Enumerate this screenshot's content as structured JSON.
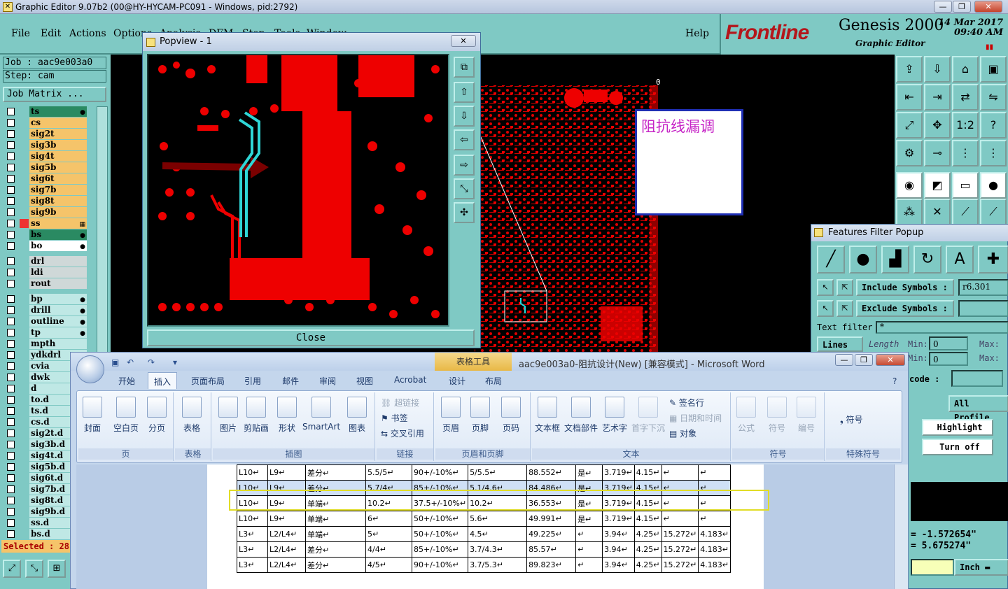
{
  "window": {
    "title": "Graphic Editor 9.07b2 (00@HY-HYCAM-PC091 - Windows, pid:2792)",
    "min": "—",
    "max": "❐",
    "close": "✕"
  },
  "menu": {
    "items": [
      "File",
      "Edit",
      "Actions",
      "Options",
      "Analysis",
      "DFM",
      "Step",
      "Tools",
      "Window"
    ],
    "help": "Help"
  },
  "brand": {
    "logo": "Frontline",
    "product": "Genesis 2000",
    "subtitle": "Graphic Editor",
    "date_line1": "14 Mar 2017",
    "date_line2": "09:40 AM"
  },
  "job": {
    "job": "Job : aac9e003a0",
    "step": "Step: cam",
    "matrix_btn": "Job Matrix ..."
  },
  "layers": [
    {
      "name": "ts",
      "style": "grn",
      "mark": "●"
    },
    {
      "name": "cs",
      "style": "yel",
      "mark": ""
    },
    {
      "name": "sig2t",
      "style": "yel",
      "mark": ""
    },
    {
      "name": "sig3b",
      "style": "yel",
      "mark": ""
    },
    {
      "name": "sig4t",
      "style": "yel",
      "mark": ""
    },
    {
      "name": "sig5b",
      "style": "yel",
      "mark": ""
    },
    {
      "name": "sig6t",
      "style": "yel",
      "mark": ""
    },
    {
      "name": "sig7b",
      "style": "yel",
      "mark": ""
    },
    {
      "name": "sig8t",
      "style": "yel",
      "mark": ""
    },
    {
      "name": "sig9b",
      "style": "yel",
      "mark": ""
    },
    {
      "name": "ss",
      "style": "yel",
      "mark": "▦"
    },
    {
      "name": "bs",
      "style": "grn",
      "mark": "●"
    },
    {
      "name": "bo",
      "style": "wht",
      "mark": "●"
    },
    {
      "name": "drl",
      "style": "gry",
      "mark": ""
    },
    {
      "name": "ldi",
      "style": "gry",
      "mark": ""
    },
    {
      "name": "rout",
      "style": "gry",
      "mark": ""
    },
    {
      "name": "bp",
      "style": "cyn",
      "mark": "●"
    },
    {
      "name": "drill",
      "style": "cyn",
      "mark": "●"
    },
    {
      "name": "outline",
      "style": "cyn",
      "mark": "●"
    },
    {
      "name": "tp",
      "style": "cyn",
      "mark": "●"
    },
    {
      "name": "mpth",
      "style": "cyn",
      "mark": ""
    },
    {
      "name": "ydkdrl",
      "style": "cyn",
      "mark": ""
    },
    {
      "name": "cvia",
      "style": "cyn",
      "mark": ""
    },
    {
      "name": "dwk",
      "style": "cyn",
      "mark": ""
    },
    {
      "name": "d",
      "style": "cyn",
      "mark": ""
    },
    {
      "name": "to.d",
      "style": "cyn",
      "mark": ""
    },
    {
      "name": "ts.d",
      "style": "cyn",
      "mark": ""
    },
    {
      "name": "cs.d",
      "style": "cyn",
      "mark": ""
    },
    {
      "name": "sig2t.d",
      "style": "cyn",
      "mark": ""
    },
    {
      "name": "sig3b.d",
      "style": "cyn",
      "mark": ""
    },
    {
      "name": "sig4t.d",
      "style": "cyn",
      "mark": ""
    },
    {
      "name": "sig5b.d",
      "style": "cyn",
      "mark": ""
    },
    {
      "name": "sig6t.d",
      "style": "cyn",
      "mark": ""
    },
    {
      "name": "sig7b.d",
      "style": "cyn",
      "mark": ""
    },
    {
      "name": "sig8t.d",
      "style": "cyn",
      "mark": ""
    },
    {
      "name": "sig9b.d",
      "style": "cyn",
      "mark": ""
    },
    {
      "name": "ss.d",
      "style": "cyn",
      "mark": ""
    },
    {
      "name": "bs.d",
      "style": "cyn",
      "mark": ""
    }
  ],
  "selected": "Selected : 28",
  "canvas_marker": "0",
  "popview": {
    "title": "Popview - 1",
    "close": "Close"
  },
  "note": "阻抗线漏调",
  "features_filter": {
    "title": "Features Filter Popup",
    "include_label": "Include Symbols :",
    "include_value": "r6.301",
    "exclude_label": "Exclude Symbols :",
    "exclude_value": "",
    "text_filter_label": "Text filter",
    "text_filter_value": "*",
    "lines_label": "Lines",
    "length_label": "Length",
    "min_label": "Min:",
    "max_label": "Max:",
    "min_value": "0",
    "code_label": "code :",
    "all_profile": "All Profile",
    "highlight": "Highlight",
    "turn_off": "Turn off",
    "coord_x": "= -1.572654\"",
    "coord_y": "=  5.675274\"",
    "unit": "Inch"
  },
  "word": {
    "title": "aac9e003a0-阻抗设计(New) [兼容模式] - Microsoft Word",
    "context_tab": "表格工具",
    "tabs": [
      "开始",
      "插入",
      "页面布局",
      "引用",
      "邮件",
      "审阅",
      "视图",
      "Acrobat",
      "设计",
      "布局"
    ],
    "groups": {
      "page": {
        "label": "页",
        "cover": "封面",
        "blank": "空白页",
        "break": "分页"
      },
      "table": {
        "label": "表格",
        "table": "表格"
      },
      "illus": {
        "label": "插图",
        "picture": "图片",
        "clipart": "剪贴画",
        "shape": "形状",
        "smartart": "SmartArt",
        "chart": "图表"
      },
      "link": {
        "label": "链接",
        "hyperlink": "超链接",
        "bookmark": "书签",
        "crossref": "交叉引用"
      },
      "hf": {
        "label": "页眉和页脚",
        "header": "页眉",
        "footer": "页脚",
        "pagenum": "页码"
      },
      "text": {
        "label": "文本",
        "textbox": "文本框",
        "quickparts": "文档部件",
        "wordart": "艺术字",
        "dropcap": "首字下沉",
        "sigline": "签名行",
        "datetime": "日期和时间",
        "object": "对象"
      },
      "symbols": {
        "label": "符号",
        "equation": "公式",
        "symbol": "符号",
        "number": "编号"
      },
      "special": {
        "label": "特殊符号",
        "symbol": "符号"
      }
    },
    "table_rows": [
      [
        "L10↵",
        "L9↵",
        "差分↵",
        "5.5/5↵",
        "90+/-10%↵",
        "5/5.5↵",
        "88.552↵",
        "是↵",
        "3.719↵",
        "4.15↵",
        "↵",
        "↵"
      ],
      [
        "L10↵",
        "L9↵",
        "差分↵",
        "5.7/4↵",
        "85+/-10%↵",
        "5.1/4.6↵",
        "84.486↵",
        "是↵",
        "3.719↵",
        "4.15↵",
        "↵",
        "↵"
      ],
      [
        "L10↵",
        "L9↵",
        "单端↵",
        "10.2↵",
        "37.5+/-10%↵",
        "10.2↵",
        "36.553↵",
        "是↵",
        "3.719↵",
        "4.15↵",
        "↵",
        "↵"
      ],
      [
        "L10↵",
        "L9↵",
        "单端↵",
        "6↵",
        "50+/-10%↵",
        "5.6↵",
        "49.991↵",
        "是↵",
        "3.719↵",
        "4.15↵",
        "↵",
        "↵"
      ],
      [
        "L3↵",
        "L2/L4↵",
        "单端↵",
        "5↵",
        "50+/-10%↵",
        "4.5↵",
        "49.225↵",
        "↵",
        "3.94↵",
        "4.25↵",
        "15.272↵",
        "4.183↵"
      ],
      [
        "L3↵",
        "L2/L4↵",
        "差分↵",
        "4/4↵",
        "85+/-10%↵",
        "3.7/4.3↵",
        "85.57↵",
        "↵",
        "3.94↵",
        "4.25↵",
        "15.272↵",
        "4.183↵"
      ],
      [
        "L3↵",
        "L2/L4↵",
        "差分↵",
        "4/5↵",
        "90+/-10%↵",
        "3.7/5.3↵",
        "89.823↵",
        "↵",
        "3.94↵",
        "4.25↵",
        "15.272↵",
        "4.183↵"
      ]
    ]
  }
}
